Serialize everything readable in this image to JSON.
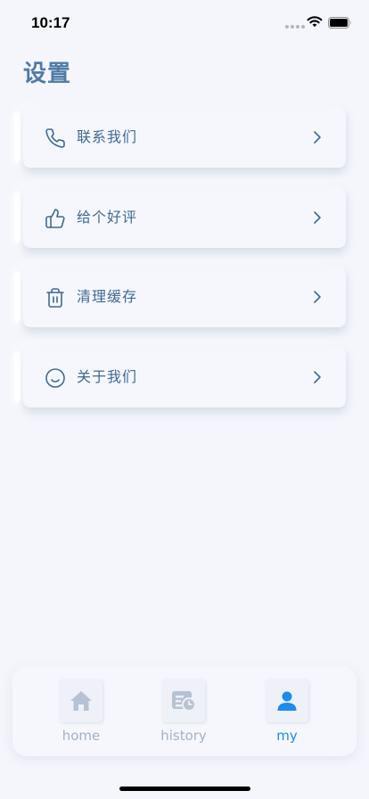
{
  "status_bar": {
    "time": "10:17"
  },
  "page": {
    "title": "设置"
  },
  "menu": {
    "items": [
      {
        "label": "联系我们",
        "icon": "phone-icon"
      },
      {
        "label": "给个好评",
        "icon": "thumbs-up-icon"
      },
      {
        "label": "清理缓存",
        "icon": "trash-icon"
      },
      {
        "label": "关于我们",
        "icon": "smile-icon"
      }
    ]
  },
  "tab_bar": {
    "tabs": [
      {
        "label": "home",
        "icon": "home-icon",
        "active": false
      },
      {
        "label": "history",
        "icon": "history-icon",
        "active": false
      },
      {
        "label": "my",
        "icon": "user-icon",
        "active": true
      }
    ]
  },
  "colors": {
    "accent": "#1d8bf0",
    "title": "#4e7ba6",
    "menu_text": "#3f6a93",
    "inactive_tab": "#a3b1c4",
    "background": "#f4f6fb"
  }
}
